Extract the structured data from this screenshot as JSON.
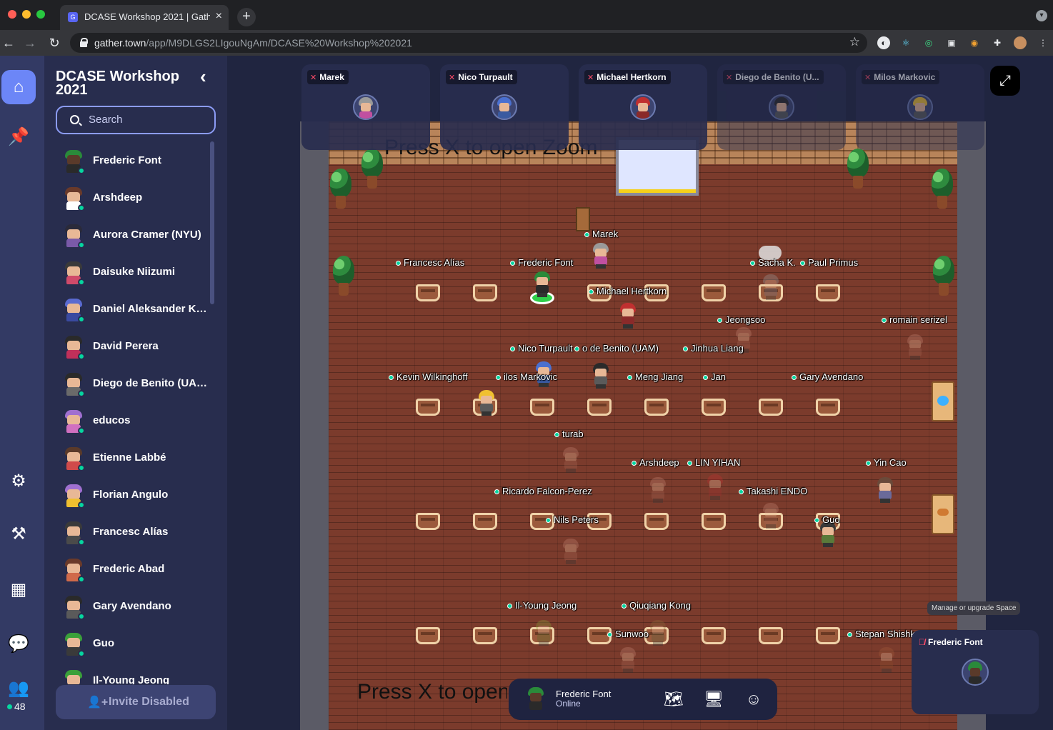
{
  "browser": {
    "tab_title": "DCASE Workshop 2021 | Gather",
    "tab_close": "×",
    "new_tab": "+",
    "url_domain": "gather.town",
    "url_path": "/app/M9DLGS2LIgouNgAm/DCASE%20Workshop%202021",
    "traffic_colors": [
      "#ff5f57",
      "#febc2e",
      "#28c840"
    ]
  },
  "sidebar": {
    "space_title": "DCASE Workshop 2021",
    "search_placeholder": "Search",
    "invite_label": "Invite Disabled",
    "participant_count": "48",
    "users": [
      {
        "name": "Frederic Font",
        "hair": "#2a8a3a",
        "face": "#5a3a2a",
        "body": "#2a2a2a"
      },
      {
        "name": "Arshdeep",
        "hair": "#6a3a2a",
        "face": "#e8b896",
        "body": "#ffffff"
      },
      {
        "name": "Aurora Cramer (NYU)",
        "hair": "#2a2a3a",
        "face": "#e8b896",
        "body": "#7a5aa8"
      },
      {
        "name": "Daisuke Niizumi",
        "hair": "#3a3a3a",
        "face": "#e8b896",
        "body": "#d04a6a"
      },
      {
        "name": "Daniel Aleksander Kr...",
        "hair": "#5a6ad0",
        "face": "#e8b896",
        "body": "#3a4aa0"
      },
      {
        "name": "David Perera",
        "hair": "#2a2a2a",
        "face": "#e8b896",
        "body": "#c0305a"
      },
      {
        "name": "Diego de Benito (UAM)",
        "hair": "#2a2a2a",
        "face": "#e8b896",
        "body": "#6a6a6a"
      },
      {
        "name": "educos",
        "hair": "#a070d0",
        "face": "#e8b896",
        "body": "#d070c0"
      },
      {
        "name": "Etienne Labbé",
        "hair": "#5a3a2a",
        "face": "#e8b896",
        "body": "#d04a4a"
      },
      {
        "name": "Florian Angulo",
        "hair": "#a070d0",
        "face": "#e8b896",
        "body": "#f0c030"
      },
      {
        "name": "Francesc Alías",
        "hair": "#3a3a3a",
        "face": "#e8b896",
        "body": "#4a4a4a"
      },
      {
        "name": "Frederic Abad",
        "hair": "#6a3a2a",
        "face": "#e8b896",
        "body": "#d06a4a"
      },
      {
        "name": "Gary Avendano",
        "hair": "#2a2a2a",
        "face": "#e8b896",
        "body": "#5a5a5a"
      },
      {
        "name": "Guo",
        "hair": "#3aa03a",
        "face": "#e8b896",
        "body": "#3a3a3a"
      },
      {
        "name": "Il-Young Jeong",
        "hair": "#3aa03a",
        "face": "#e8b896",
        "body": "#3a3a3a"
      }
    ]
  },
  "videos": [
    {
      "name": "Marek",
      "hair": "#9a9a9a",
      "body": "#c050a0",
      "faded": false
    },
    {
      "name": "Nico Turpault",
      "hair": "#4a70d0",
      "body": "#3a5aa0",
      "faded": false
    },
    {
      "name": "Michael Hertkorn",
      "hair": "#c03030",
      "body": "#8a2a2a",
      "faded": false
    },
    {
      "name": "Diego de Benito (U...",
      "hair": "#2a2a2a",
      "body": "#5a5a5a",
      "faded": true
    },
    {
      "name": "Milos Markovic",
      "hair": "#f0c030",
      "body": "#5a5a5a",
      "faded": true
    }
  ],
  "map": {
    "zoom_text_top": "Press X to open Zoom",
    "zoom_text_bottom": "Press X to open Zoom",
    "labels": [
      "Marek",
      "Francesc Alías",
      "Frederic Font",
      "Sacha K.",
      "Paul Primus",
      "Michael Hertkorn",
      "Jeongsoo",
      "romain serizel",
      "Nico Turpault",
      "o de Benito (UAM)",
      "Jinhua Liang",
      "Kevin Wilkinghoff",
      "ilos Markovic",
      "Meng Jiang",
      "Jan",
      "Gary Avendano",
      "turab",
      "Arshdeep",
      "LIN YIHAN",
      "Yin Cao",
      "Ricardo Falcon-Perez",
      "Takashi ENDO",
      "Nils Peters",
      "Guo",
      "Il-Young Jeong",
      "Qiuqiang Kong",
      "Sunwoo",
      "Stepan Shishk"
    ]
  },
  "self": {
    "tooltip": "Manage or upgrade Space",
    "name": "Frederic Font",
    "status": "Online"
  }
}
